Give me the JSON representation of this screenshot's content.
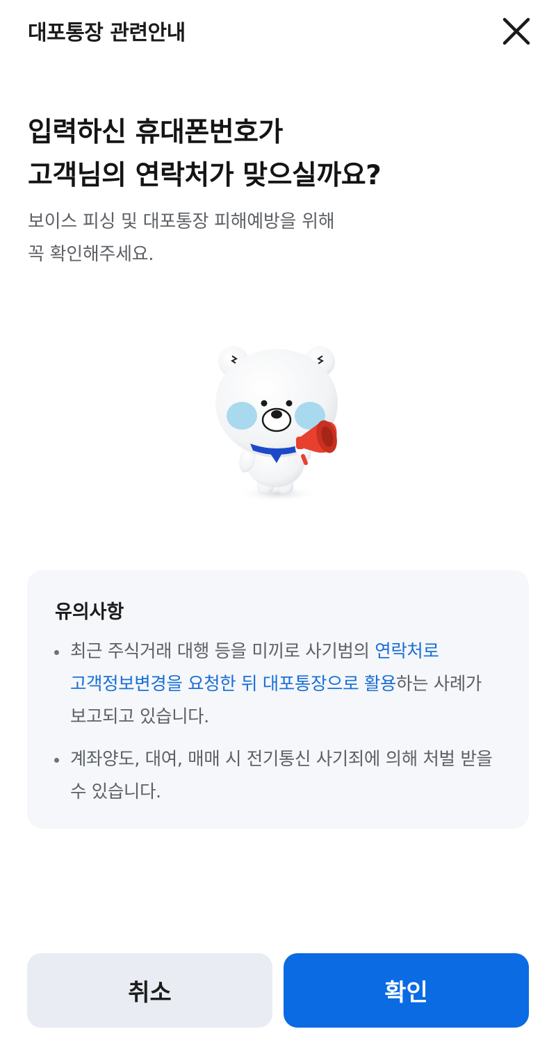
{
  "header": {
    "title": "대포통장 관련안내",
    "close_icon": "close-icon"
  },
  "headline": {
    "line1": "입력하신 휴대폰번호가",
    "line2": "고객님의 연락처가 맞으실까요?"
  },
  "subtext": {
    "line1": "보이스 피싱 및 대포통장 피해예방을 위해",
    "line2": "꼭 확인해주세요."
  },
  "mascot": {
    "icon": "bear-megaphone-icon"
  },
  "notice": {
    "title": "유의사항",
    "items": [
      {
        "before": "최근 주식거래 대행 등을 미끼로 사기범의 ",
        "highlight": "연락처로 고객정보변경을 요청한 뒤 대포통장으로 활용",
        "after": "하는 사례가 보고되고 있습니다."
      },
      {
        "text": "계좌양도, 대여, 매매 시 전기통신 사기죄에 의해 처벌 받을 수 있습니다."
      }
    ]
  },
  "buttons": {
    "cancel": "취소",
    "confirm": "확인"
  },
  "colors": {
    "accent": "#0a6be3",
    "highlight_text": "#1a6fd6",
    "notice_bg": "#f5f7fa",
    "cancel_bg": "#e9ecf2"
  }
}
